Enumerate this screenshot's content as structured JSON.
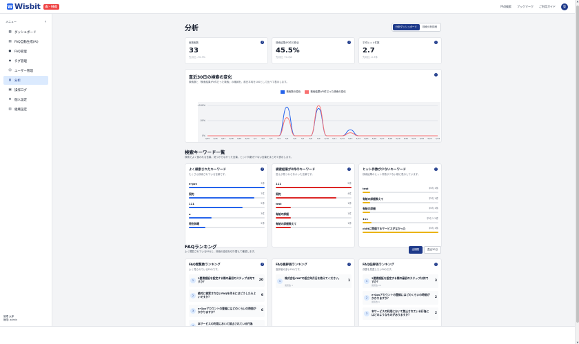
{
  "header": {
    "brand": "Wisbit",
    "badge": "AI・FAQ",
    "nav": [
      "FAQ検索",
      "ブックマーク",
      "ご利用ガイド"
    ],
    "avatar": "管"
  },
  "sidebar": {
    "heading": "メニュー",
    "collapse_icon": "chevron-left-icon",
    "items": [
      {
        "label": "ダッシュボード",
        "icon": "grid-icon",
        "active": false
      },
      {
        "label": "FAQ自動生成(AI)",
        "icon": "document-icon",
        "active": false
      },
      {
        "label": "FAQ管理",
        "icon": "chat-icon",
        "active": false
      },
      {
        "label": "タグ管理",
        "icon": "tag-icon",
        "active": false
      },
      {
        "label": "ユーザー管理",
        "icon": "user-icon",
        "active": false
      },
      {
        "label": "分析",
        "icon": "bar-chart-icon",
        "active": true
      },
      {
        "label": "操作ログ",
        "icon": "log-icon",
        "active": false
      },
      {
        "label": "個人設定",
        "icon": "gear-icon",
        "active": false
      },
      {
        "label": "組織設定",
        "icon": "building-icon",
        "active": false
      }
    ],
    "user_name": "管理 太郎",
    "user_role": "権限: admin"
  },
  "page": {
    "title": "分析",
    "view_tabs": [
      "分析ダッシュボード",
      "検索分析詳細"
    ]
  },
  "kpis": [
    {
      "label": "総検索数",
      "value": "33",
      "sub": "先月比 -70.3%"
    },
    {
      "label": "検索結果が0件の割合",
      "value": "45.5%",
      "sub": "先月比 +0.7pt"
    },
    {
      "label": "平均ヒット件数",
      "value": "2.7",
      "sub": "先月比 -0.3件"
    }
  ],
  "trend": {
    "title": "直近30日の検索の変化",
    "desc": "検索数と「検索結果が0件だった検索」の増減を、前日平均を100として比べて表示します。",
    "legend": [
      "検索数の変化",
      "検索結果が0件だった検索の変化"
    ]
  },
  "chart_data": {
    "type": "line",
    "x": [
      "4/25",
      "4/26",
      "4/27",
      "4/28",
      "4/29",
      "4/30",
      "5/1",
      "5/2",
      "5/3",
      "5/4",
      "5/5",
      "5/6",
      "5/7",
      "5/8",
      "5/9",
      "5/10",
      "5/11",
      "5/12",
      "5/13",
      "5/14",
      "5/15",
      "5/16",
      "5/17",
      "5/18",
      "5/19",
      "5/20",
      "5/21",
      "5/22",
      "5/23",
      "5/24"
    ],
    "yticks": [
      "+100%",
      "-50%",
      "0%"
    ],
    "series": [
      {
        "name": "検索数の変化",
        "color": "#2563eb",
        "values": [
          0,
          0,
          0,
          0,
          0,
          0,
          0,
          0,
          0,
          0,
          95,
          0,
          0,
          0,
          90,
          0,
          0,
          0,
          20,
          0,
          0,
          0,
          0,
          0,
          0,
          0,
          0,
          0,
          0,
          0
        ]
      },
      {
        "name": "検索結果が0件だった検索の変化",
        "color": "#f87171",
        "values": [
          0,
          0,
          0,
          0,
          0,
          0,
          0,
          0,
          0,
          0,
          60,
          0,
          0,
          0,
          100,
          0,
          0,
          0,
          10,
          0,
          0,
          0,
          0,
          0,
          0,
          0,
          0,
          0,
          0,
          0
        ]
      }
    ]
  },
  "keywords_section": {
    "title": "検索キーワード一覧",
    "desc": "検索でよく使われる言葉、見つからなかった言葉、ヒット件数が少ない言葉をまとめて表示します。"
  },
  "keyword_cards": [
    {
      "title": "よく検索されたキーワード",
      "desc": "たくさん検索されている言葉です。",
      "color": "#2563eb",
      "rows": [
        {
          "name": "e-gov",
          "count": "3件",
          "ratio": 1.0
        },
        {
          "name": "契約",
          "count": "7件",
          "ratio": 0.86
        },
        {
          "name": "111",
          "count": "5件",
          "ratio": 0.71
        },
        {
          "name": "a",
          "count": "3件",
          "ratio": 0.3
        },
        {
          "name": "特別休暇",
          "count": "2件",
          "ratio": 0.22
        }
      ]
    },
    {
      "title": "検索結果が0件のキーワード",
      "desc": "答えが見つからなかった言葉です。",
      "color": "#dc2626",
      "rows": [
        {
          "name": "111",
          "count": "5件",
          "ratio": 1.0
        },
        {
          "name": "契約",
          "count": "4件",
          "ratio": 0.8
        },
        {
          "name": "test",
          "count": "1件",
          "ratio": 0.2
        },
        {
          "name": "有給の詳細",
          "count": "1件",
          "ratio": 0.2
        },
        {
          "name": "有給の詳細教えて",
          "count": "1件",
          "ratio": 0.2
        }
      ]
    },
    {
      "title": "ヒット件数が少ないキーワード",
      "desc": "検索結果のヒット件数が少ない順に表示しています。",
      "color": "#eab308",
      "rows": [
        {
          "name": "test",
          "count": "平均 1件",
          "ratio": 0.1
        },
        {
          "name": "有給の詳細教えて",
          "count": "平均 1件",
          "ratio": 0.1
        },
        {
          "name": "有給の詳細",
          "count": "平均 1件",
          "ratio": 0.1
        },
        {
          "name": "111",
          "count": "平均 1.2件",
          "ratio": 0.12
        },
        {
          "name": "chiitに関連するサービスがなかった",
          "count": "平均 1件",
          "ratio": 1.0
        }
      ]
    }
  ],
  "ranking_section": {
    "title": "FAQランキング",
    "desc": "よく閲覧されているFAQと、評価の高低を切り替えて確認します。",
    "tabs": [
      "全期間",
      "直近30日"
    ]
  },
  "ranking_cards": [
    {
      "title": "FAQ閲覧数ランキング",
      "desc": "よく見られているFAQです。",
      "rows": [
        {
          "rank": "1",
          "q": "2要素認証を設定する際の最初のステップは何ですか？",
          "count": "20",
          "sub": ""
        },
        {
          "rank": "2",
          "q": "絶対に検索されないFAQを作るにはどうしたらよいですか？",
          "count": "6",
          "sub": ""
        },
        {
          "rank": "3",
          "q": "e-Govアカウントの登録にはどのくらいの時間がかかりますか？",
          "count": "6",
          "sub": ""
        },
        {
          "rank": "4",
          "q": "本サービスの利用において禁止されている行為",
          "count": "",
          "sub": ""
        }
      ]
    },
    {
      "title": "FAQ高評価ランキング",
      "desc": "高評価の多いFAQです。",
      "rows": [
        {
          "rank": "1",
          "q": "株式会社CBITの設立年月日を教えてください。",
          "count": "1",
          "sub": "閲覧数 3"
        }
      ]
    },
    {
      "title": "FAQ低評価ランキング",
      "desc": "改善を見直したいFAQです。",
      "rows": [
        {
          "rank": "1",
          "q": "2要素認証を設定する際の最初のステップは何ですか？",
          "count": "3",
          "sub": "閲覧数 20"
        },
        {
          "rank": "2",
          "q": "e-Govアカウントの登録にはどのくらいの時間がかかりますか？",
          "count": "2",
          "sub": "閲覧数 6"
        },
        {
          "rank": "3",
          "q": "本サービスの利用において禁止されている行為にはどのようなものがありますか？",
          "count": "2",
          "sub": ""
        }
      ]
    }
  ]
}
